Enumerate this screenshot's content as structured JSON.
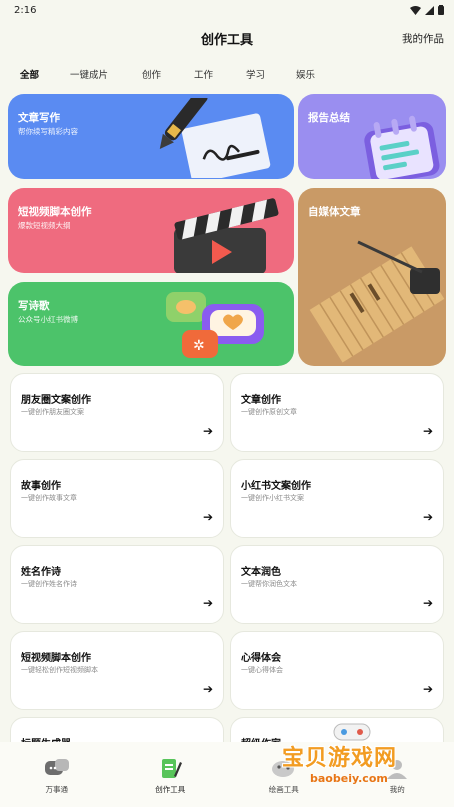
{
  "status": {
    "time": "2:16"
  },
  "header": {
    "title": "创作工具",
    "right_link": "我的作品"
  },
  "tabs": [
    "全部",
    "一键成片",
    "创作",
    "工作",
    "学习",
    "娱乐"
  ],
  "features": {
    "article": {
      "title": "文章写作",
      "subtitle": "帮你续写精彩内容"
    },
    "report": {
      "title": "报告总结"
    },
    "video": {
      "title": "短视频脚本创作",
      "subtitle": "爆款短视频大纲"
    },
    "media": {
      "title": "自媒体文章"
    },
    "poem": {
      "title": "写诗歌",
      "subtitle": "公众号小红书微博"
    }
  },
  "tools": [
    {
      "title": "朋友圈文案创作",
      "subtitle": "一键创作朋友圈文案"
    },
    {
      "title": "文章创作",
      "subtitle": "一键创作原创文章"
    },
    {
      "title": "故事创作",
      "subtitle": "一键创作故事文章"
    },
    {
      "title": "小红书文案创作",
      "subtitle": "一键创作小红书文案"
    },
    {
      "title": "姓名作诗",
      "subtitle": "一键创作姓名作诗"
    },
    {
      "title": "文本润色",
      "subtitle": "一键帮你润色文本"
    },
    {
      "title": "短视频脚本创作",
      "subtitle": "一键轻松创作短视频脚本"
    },
    {
      "title": "心得体会",
      "subtitle": "一键心得体会"
    },
    {
      "title": "标题生成器",
      "subtitle": ""
    },
    {
      "title": "超级作家",
      "subtitle": ""
    }
  ],
  "nav": [
    "万事通",
    "创作工具",
    "绘画工具",
    "我的"
  ],
  "watermark": {
    "text": "宝贝游戏网",
    "url": "baobeiy.com"
  },
  "colors": {
    "article": "#5a8bf2",
    "report": "#9a8ef0",
    "video": "#ef6b7f",
    "media": "#c99a66",
    "poem": "#4cc36a"
  }
}
